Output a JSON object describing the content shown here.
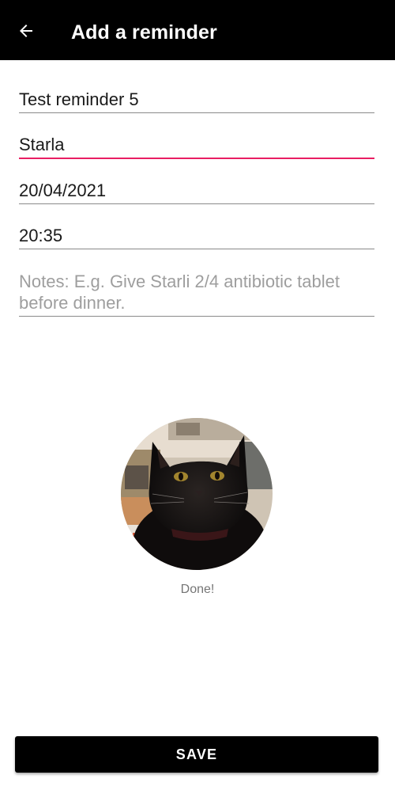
{
  "app_bar": {
    "back_icon": "arrow-left-icon",
    "title": "Add a reminder"
  },
  "form": {
    "reminder_name": "Test reminder 5",
    "pet_name": "Starla",
    "date": "20/04/2021",
    "time": "20:35",
    "notes_placeholder": "Notes: E.g. Give Starli 2/4 antibiotic tablet before dinner."
  },
  "photo": {
    "status": "Done!"
  },
  "actions": {
    "save_label": "SAVE"
  },
  "colors": {
    "app_bar": "#000000",
    "accent": "#e91e63",
    "button": "#000000"
  }
}
